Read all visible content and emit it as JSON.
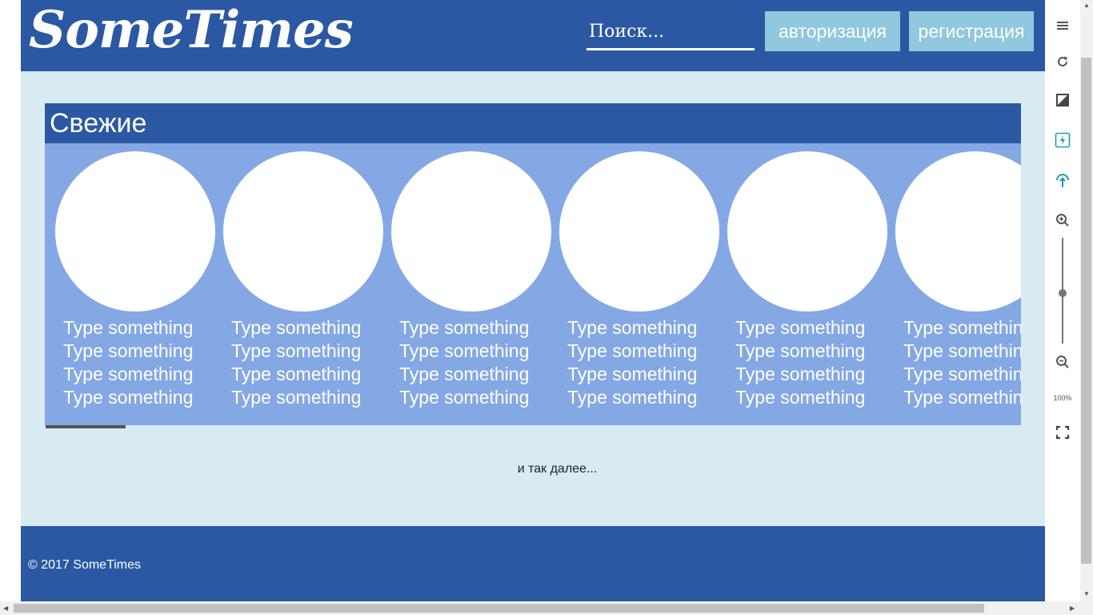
{
  "header": {
    "logo": "SomeTimes",
    "search_placeholder": "Поиск...",
    "login_label": "авторизация",
    "register_label": "регистрация"
  },
  "section": {
    "title": "Свежие",
    "cards": [
      {
        "lines": [
          "Type something",
          "Type something",
          "Type something",
          "Type something"
        ]
      },
      {
        "lines": [
          "Type something",
          "Type something",
          "Type something",
          "Type something"
        ]
      },
      {
        "lines": [
          "Type something",
          "Type something",
          "Type something",
          "Type something"
        ]
      },
      {
        "lines": [
          "Type something",
          "Type something",
          "Type something",
          "Type something"
        ]
      },
      {
        "lines": [
          "Type something",
          "Type something",
          "Type something",
          "Type something"
        ]
      },
      {
        "lines": [
          "Type something",
          "Type something",
          "Type something",
          "Type something"
        ]
      }
    ]
  },
  "more_text": "и так далее...",
  "footer": {
    "copyright": "© 2017 SomeTimes"
  },
  "toolbar": {
    "zoom_level": "100%"
  },
  "colors": {
    "header_bg": "#2b58a3",
    "page_bg": "#d8ebf3",
    "cards_bg": "#84a8e4",
    "button_bg": "#90c8de",
    "accent_teal": "#1a9fb0"
  }
}
